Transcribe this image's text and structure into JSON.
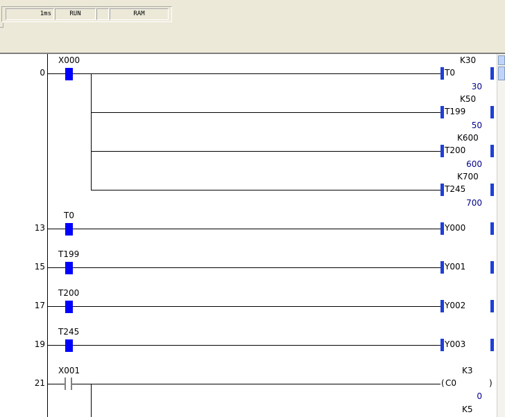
{
  "status": {
    "scan": "1ms",
    "mode": "RUN",
    "memory": "RAM"
  },
  "steps": [
    "0",
    "13",
    "15",
    "17",
    "19",
    "21"
  ],
  "rungs": {
    "r0": {
      "contact": "X000",
      "coils": [
        {
          "name": "T0",
          "const": "K30",
          "value": "30"
        },
        {
          "name": "T199",
          "const": "K50",
          "value": "50"
        },
        {
          "name": "T200",
          "const": "K600",
          "value": "600"
        },
        {
          "name": "T245",
          "const": "K700",
          "value": "700"
        }
      ]
    },
    "r13": {
      "contact": "T0",
      "coil": "Y000"
    },
    "r15": {
      "contact": "T199",
      "coil": "Y001"
    },
    "r17": {
      "contact": "T200",
      "coil": "Y002"
    },
    "r19": {
      "contact": "T245",
      "coil": "Y003"
    },
    "r21": {
      "contact": "X001",
      "coil": "C0",
      "const": "K3",
      "value": "0",
      "next_const": "K5"
    }
  },
  "colors": {
    "contact_on": "#0000ff",
    "coil_marker": "#1f3fd6",
    "value_text": "#00008b"
  }
}
